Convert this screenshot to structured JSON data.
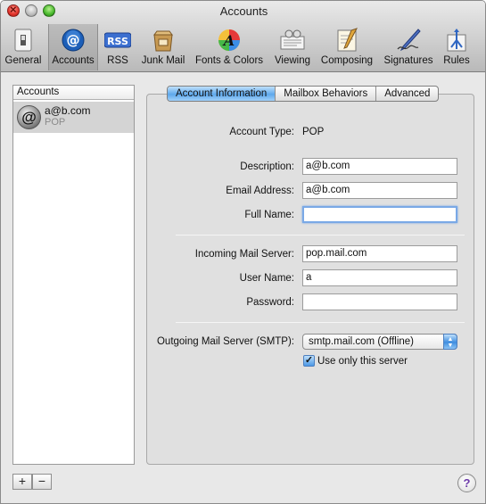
{
  "window": {
    "title": "Accounts"
  },
  "toolbar": {
    "items": [
      {
        "label": "General",
        "icon": "general-switch-icon"
      },
      {
        "label": "Accounts",
        "icon": "at-sign-icon",
        "selected": true
      },
      {
        "label": "RSS",
        "icon": "rss-icon"
      },
      {
        "label": "Junk Mail",
        "icon": "junk-mail-icon"
      },
      {
        "label": "Fonts & Colors",
        "icon": "fonts-colors-icon"
      },
      {
        "label": "Viewing",
        "icon": "viewing-icon"
      },
      {
        "label": "Composing",
        "icon": "composing-icon"
      },
      {
        "label": "Signatures",
        "icon": "signatures-icon"
      },
      {
        "label": "Rules",
        "icon": "rules-icon"
      }
    ]
  },
  "sidebar": {
    "header": "Accounts",
    "accounts": [
      {
        "name": "a@b.com",
        "type": "POP",
        "avatar_glyph": "@"
      }
    ]
  },
  "tabs": [
    {
      "label": "Account Information",
      "active": true
    },
    {
      "label": "Mailbox Behaviors",
      "active": false
    },
    {
      "label": "Advanced",
      "active": false
    }
  ],
  "form": {
    "account_type_label": "Account Type:",
    "account_type_value": "POP",
    "description_label": "Description:",
    "description_value": "a@b.com",
    "email_label": "Email Address:",
    "email_value": "a@b.com",
    "fullname_label": "Full Name:",
    "fullname_value": "",
    "incoming_label": "Incoming Mail Server:",
    "incoming_value": "pop.mail.com",
    "username_label": "User Name:",
    "username_value": "a",
    "password_label": "Password:",
    "password_value": "",
    "smtp_label": "Outgoing Mail Server (SMTP):",
    "smtp_value": "smtp.mail.com (Offline)",
    "use_only_label": "Use only this server",
    "use_only_checked": true,
    "check_glyph": "✓"
  },
  "bottom": {
    "add": "+",
    "remove": "−",
    "help": "?"
  },
  "colors": {
    "tab_active": "#5ea8ec",
    "selection_gray": "#d4d4d4",
    "close_red": "#e2322a",
    "zoom_green": "#47b82c"
  }
}
